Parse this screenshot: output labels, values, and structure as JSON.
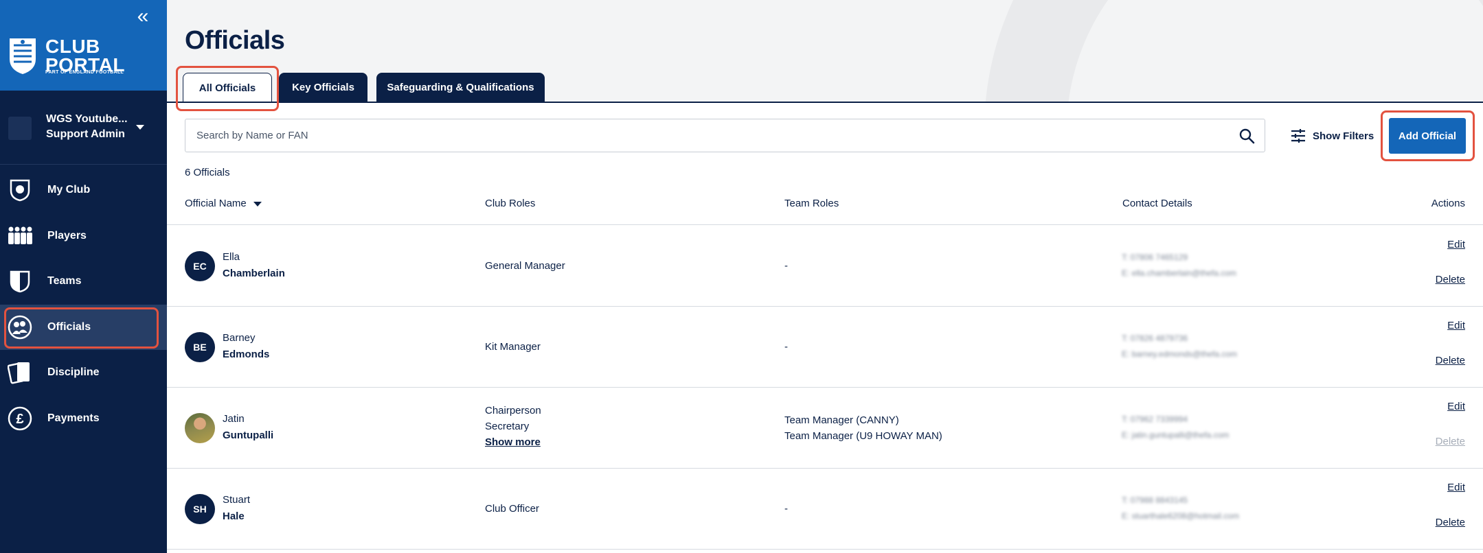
{
  "sidebar": {
    "brand_line1": "CLUB",
    "brand_line2": "PORTAL",
    "brand_sub": "PART OF ENGLAND FOOTBALL",
    "user_name": "WGS Youtube...",
    "user_role": "Support Admin",
    "items": [
      {
        "label": "My Club",
        "icon": "club-crest-icon"
      },
      {
        "label": "Players",
        "icon": "players-icon"
      },
      {
        "label": "Teams",
        "icon": "shield-icon"
      },
      {
        "label": "Officials",
        "icon": "officials-icon",
        "active": true
      },
      {
        "label": "Discipline",
        "icon": "cards-icon"
      },
      {
        "label": "Payments",
        "icon": "pound-icon"
      }
    ]
  },
  "page": {
    "title": "Officials",
    "tabs": [
      "All Officials",
      "Key Officials",
      "Safeguarding & Qualifications"
    ],
    "search_placeholder": "Search by Name or FAN",
    "show_filters": "Show Filters",
    "add_official": "Add Official",
    "count": "6 Officials"
  },
  "table": {
    "headers": [
      "Official Name",
      "Club Roles",
      "Team Roles",
      "Contact Details",
      "Actions"
    ],
    "rows": [
      {
        "initials": "EC",
        "first": "Ella",
        "last": "Chamberlain",
        "club_roles": [
          "General Manager"
        ],
        "team_roles": [
          "-"
        ],
        "show_more": "",
        "contact": [
          "T: 07806 7465129",
          "E: ella.chamberlain@thefa.com"
        ],
        "edit": "Edit",
        "delete": "Delete",
        "delete_disabled": false
      },
      {
        "initials": "BE",
        "first": "Barney",
        "last": "Edmonds",
        "club_roles": [
          "Kit Manager"
        ],
        "team_roles": [
          "-"
        ],
        "show_more": "",
        "contact": [
          "T: 07826 4879736",
          "E: barney.edmonds@thefa.com"
        ],
        "edit": "Edit",
        "delete": "Delete",
        "delete_disabled": false
      },
      {
        "initials": "",
        "first": "Jatin",
        "last": "Guntupalli",
        "club_roles": [
          "Chairperson",
          "Secretary"
        ],
        "team_roles": [
          "Team Manager (CANNY)",
          "Team Manager (U9 HOWAY MAN)"
        ],
        "show_more": "Show more",
        "contact": [
          "T: 07962 7339994",
          "E: jatin.guntupalli@thefa.com"
        ],
        "edit": "Edit",
        "delete": "Delete",
        "delete_disabled": true
      },
      {
        "initials": "SH",
        "first": "Stuart",
        "last": "Hale",
        "club_roles": [
          "Club Officer"
        ],
        "team_roles": [
          "-"
        ],
        "show_more": "",
        "contact": [
          "T: 07988 8843145",
          "E: stuarthale6208@hotmail.com"
        ],
        "edit": "Edit",
        "delete": "Delete",
        "delete_disabled": false
      }
    ]
  },
  "colors": {
    "navy": "#0b2046",
    "brand_blue": "#1466b8",
    "highlight": "#e3523f"
  }
}
